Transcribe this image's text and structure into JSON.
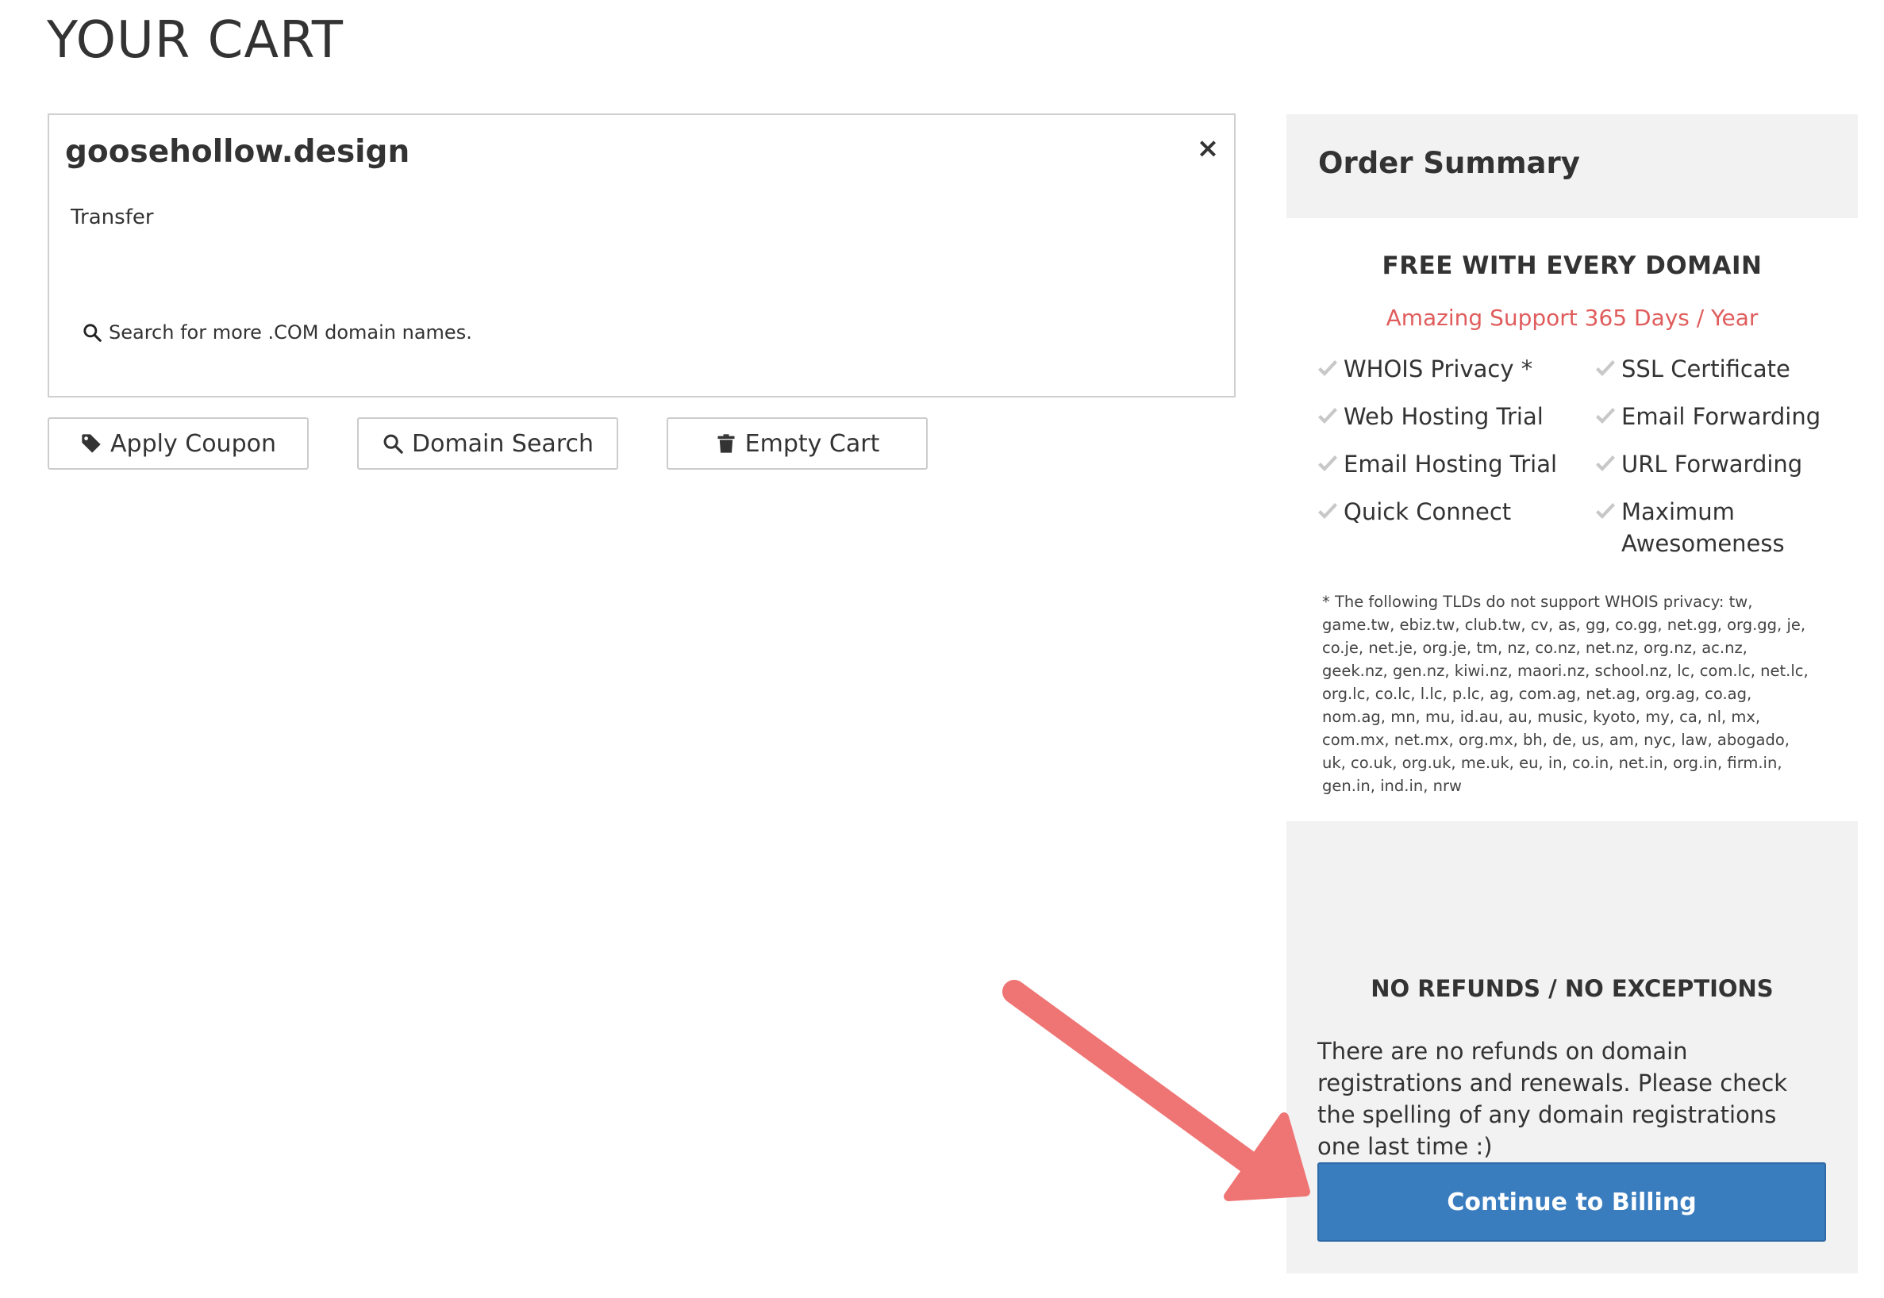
{
  "page": {
    "title": "YOUR CART"
  },
  "cart_item": {
    "domain": "goosehollow.design",
    "remove_label": "×",
    "type": "Transfer",
    "search_more": "Search for more .COM domain names."
  },
  "actions": {
    "apply_coupon": "Apply Coupon",
    "domain_search": "Domain Search",
    "empty_cart": "Empty Cart"
  },
  "summary": {
    "title": "Order Summary",
    "free_title": "FREE WITH EVERY DOMAIN",
    "free_subtitle": "Amazing Support 365 Days / Year",
    "features_left": [
      "WHOIS Privacy *",
      "Web Hosting Trial",
      "Email Hosting Trial",
      "Quick Connect"
    ],
    "features_right": [
      "SSL Certificate",
      "Email Forwarding",
      "URL Forwarding",
      "Maximum Awesomeness"
    ],
    "footnote": "* The following TLDs do not support WHOIS privacy: tw, game.tw, ebiz.tw, club.tw, cv, as, gg, co.gg, net.gg, org.gg, je, co.je, net.je, org.je, tm, nz, co.nz, net.nz, org.nz, ac.nz, geek.nz, gen.nz, kiwi.nz, maori.nz, school.nz, lc, com.lc, net.lc, org.lc, co.lc, l.lc, p.lc, ag, com.ag, net.ag, org.ag, co.ag, nom.ag, mn, mu, id.au, au, music, kyoto, my, ca, nl, mx, com.mx, net.mx, org.mx, bh, de, us, am, nyc, law, abogado, uk, co.uk, org.uk, me.uk, eu, in, co.in, net.in, org.in, firm.in, gen.in, ind.in, nrw"
  },
  "policy": {
    "title": "NO REFUNDS / NO EXCEPTIONS",
    "text": "There are no refunds on domain registrations and renewals. Please check the spelling of any domain registrations one last time :)",
    "continue_label": "Continue to Billing"
  },
  "colors": {
    "accent": "#3a7dbf",
    "support_text": "#e05c5c",
    "annotation_arrow": "#ef7575",
    "panel_bg": "#f2f2f2"
  },
  "icons": {
    "remove": "close-icon",
    "search_more": "search-icon",
    "apply_coupon": "tag-icon",
    "domain_search": "search-icon",
    "empty_cart": "trash-icon",
    "feature_check": "check-icon",
    "annotation": "arrow-icon"
  }
}
